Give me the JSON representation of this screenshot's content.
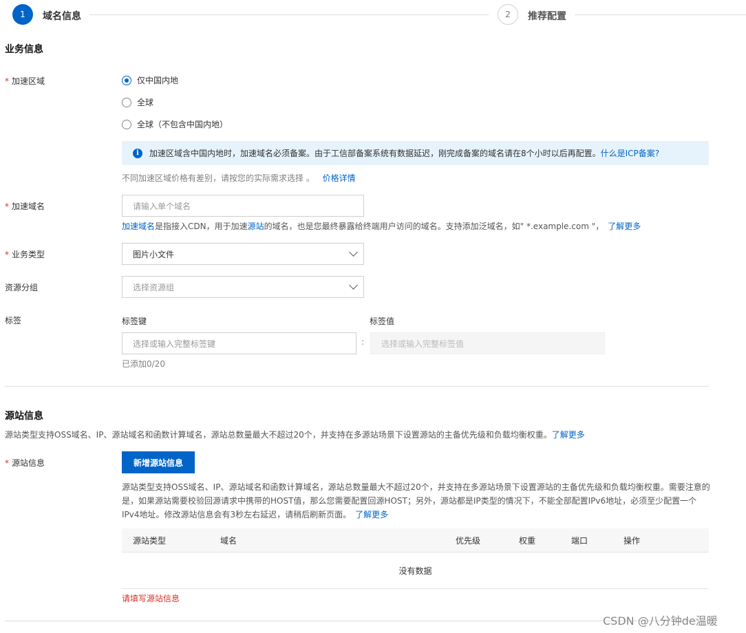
{
  "steps": [
    {
      "number": "1",
      "title": "域名信息"
    },
    {
      "number": "2",
      "title": "推荐配置"
    }
  ],
  "business": {
    "title": "业务信息",
    "accel_region": {
      "label": "加速区域",
      "options": [
        "仅中国内地",
        "全球",
        "全球（不包含中国内地）"
      ],
      "selected_index": 0,
      "info_text": "加速区域含中国内地时，加速域名必须备案。由于工信部备案系统有数据延迟，刚完成备案的域名请在8个小时以后再配置。",
      "info_link": "什么是ICP备案?",
      "price_note": "不同加速区域价格有差别，请按您的实际需求选择 。",
      "price_link": "价格详情"
    },
    "domain": {
      "label": "加速域名",
      "placeholder": "请输入单个域名",
      "help_link1": "加速域名",
      "help_text1": "是指接入CDN，用于加速",
      "help_link2": "源站",
      "help_text2": "的域名，也是您最终暴露给终端用户访问的域名。支持添加泛域名，如\" *.example.com \"，",
      "help_link3": "了解更多"
    },
    "business_type": {
      "label": "业务类型",
      "value": "图片小文件"
    },
    "resource_group": {
      "label": "资源分组",
      "placeholder": "选择资源组"
    },
    "tags": {
      "label": "标签",
      "key_label": "标签键",
      "value_label": "标签值",
      "key_placeholder": "选择或输入完整标签键",
      "separator": ":",
      "value_placeholder": "选择或输入完整标签值",
      "count": "已添加0/20"
    }
  },
  "origin": {
    "title": "源站信息",
    "desc": "源站类型支持OSS域名、IP、源站域名和函数计算域名，源站总数量最大不超过20个，并支持在多源站场景下设置源站的主备优先级和负载均衡权重。",
    "desc_link": "了解更多",
    "field_label": "源站信息",
    "add_button": "新增源站信息",
    "help_line1": "源站类型支持OSS域名、IP、源站域名和函数计算域名，源站总数量最大不超过20个，并支持在多源站场景下设置源站的主备优先级和负载均衡权重。需要注意的",
    "help_line2": "是，如果源站需要校验回源请求中携带的HOST值，那么您需要配置回源HOST；另外，源站都是IP类型的情况下，不能全部配置IPv6地址，必须至少配置一个",
    "help_line3": "IPv4地址。修改源站信息会有3秒左右延迟，请稍后刷新页面。",
    "help_link": "了解更多",
    "table": {
      "columns": [
        "源站类型",
        "域名",
        "优先级",
        "权重",
        "端口",
        "操作"
      ],
      "empty": "没有数据"
    },
    "error": "请填写源站信息"
  },
  "watermark": "CSDN @八分钟de温暖",
  "colors": {
    "primary": "#0064c8",
    "error": "#d93026",
    "info_bg": "#e6f3fc"
  }
}
